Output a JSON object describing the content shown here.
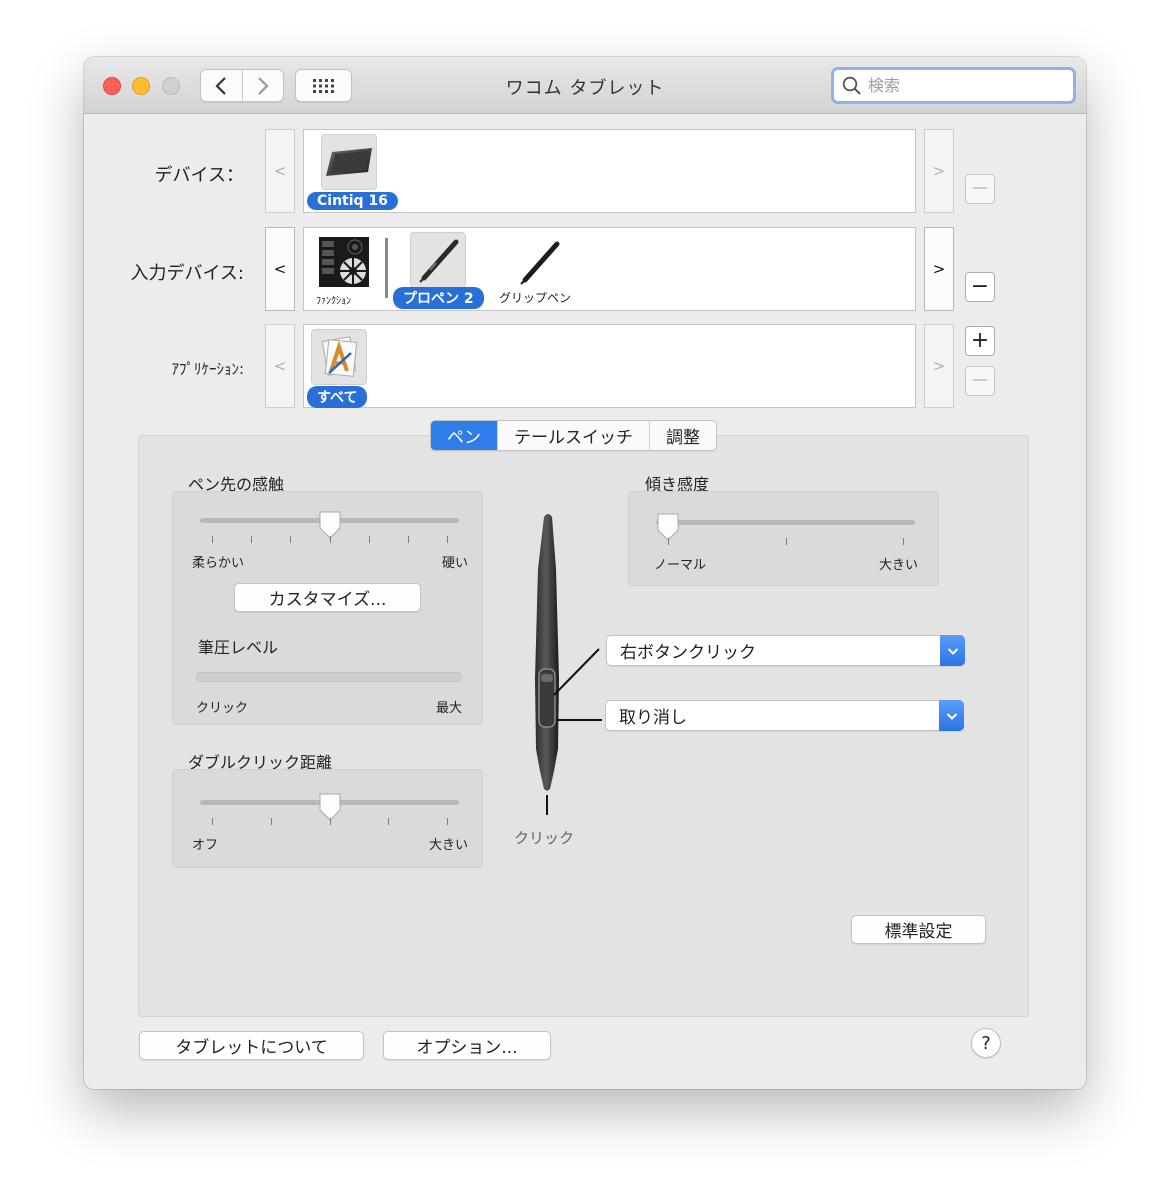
{
  "window": {
    "title": "ワコム タブレット"
  },
  "search": {
    "placeholder": "検索"
  },
  "rows": {
    "device": {
      "label": "デバイス：",
      "prev": "<",
      "next": ">",
      "items": [
        {
          "name": "Cintiq 16",
          "selected": true
        }
      ]
    },
    "input_device": {
      "label": "入力デバイス:",
      "prev": "<",
      "next": ">",
      "items": [
        {
          "name": "ﾌｧﾝｸｼｮﾝ",
          "selected": false
        },
        {
          "name": "プロペン 2",
          "selected": true
        },
        {
          "name": "グリップペン",
          "selected": false
        }
      ]
    },
    "application": {
      "label": "ｱﾌﾟﾘｹｰｼｮﾝ:",
      "prev": "<",
      "next": ">",
      "items": [
        {
          "name": "すべて",
          "selected": true
        }
      ]
    }
  },
  "buttons": {
    "add": "+",
    "remove": "−"
  },
  "tabs": [
    {
      "label": "ペン",
      "active": true
    },
    {
      "label": "テールスイッチ",
      "active": false
    },
    {
      "label": "調整",
      "active": false
    }
  ],
  "tip_feel": {
    "title": "ペン先の感触",
    "min_label": "柔らかい",
    "max_label": "硬い",
    "value": 0.5,
    "customize": "カスタマイズ..."
  },
  "pressure": {
    "title": "筆圧レベル",
    "min_label": "クリック",
    "max_label": "最大",
    "value": 0
  },
  "double_click": {
    "title": "ダブルクリック距離",
    "min_label": "オフ",
    "max_label": "大きい",
    "value": 0.5
  },
  "tilt": {
    "title": "傾き感度",
    "min_label": "ノーマル",
    "max_label": "大きい",
    "value": 0
  },
  "pen_buttons": {
    "upper": "右ボタンクリック",
    "lower": "取り消し",
    "tip": "クリック"
  },
  "default_button": "標準設定",
  "about_button": "タブレットについて",
  "options_button": "オプション...",
  "help": "?",
  "colors": {
    "accent": "#2f7de8",
    "pill": "#2870d8"
  }
}
